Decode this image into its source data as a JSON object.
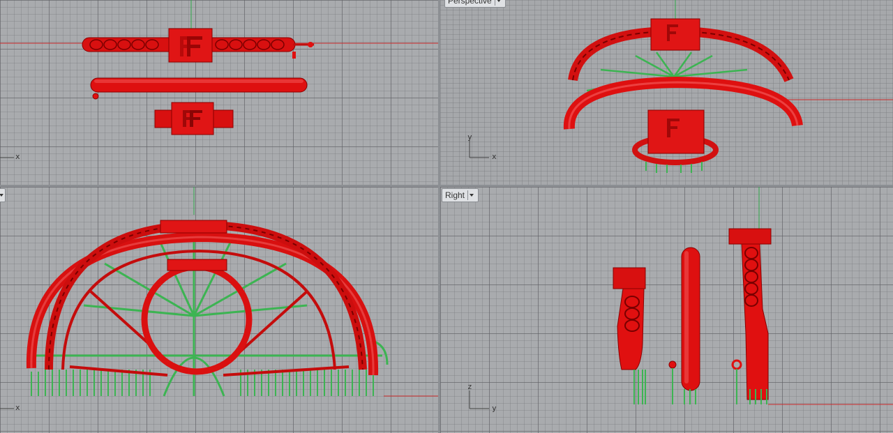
{
  "viewports": {
    "top": {
      "axis_x": "x"
    },
    "perspective": {
      "title": "Perspective",
      "axis_x": "x",
      "axis_y": "y"
    },
    "front": {
      "axis_x": "x"
    },
    "right": {
      "title": "Right",
      "axis_h": "y",
      "axis_v": "z"
    }
  },
  "colors": {
    "model_red": "#e01010",
    "support_green": "#3cb452",
    "axis_red": "#cc2a2a",
    "axis_green": "#2fa84a"
  }
}
